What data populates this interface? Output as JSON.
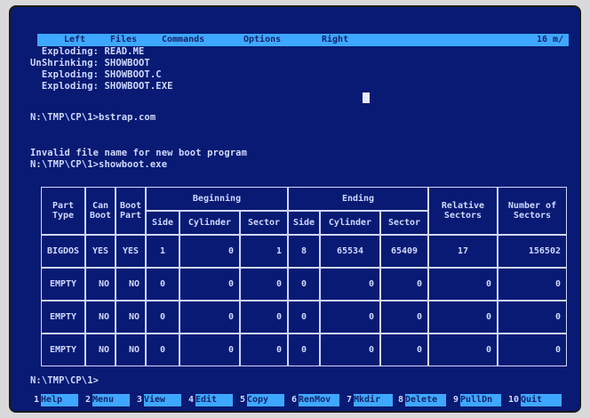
{
  "menu": {
    "items": [
      "Left",
      "Files",
      "Commands",
      "Options",
      "Right"
    ],
    "right_text": "16 m/"
  },
  "console": {
    "lines": [
      "  Exploding: READ.ME",
      "UnShrinking: SHOWBOOT",
      "  Exploding: SHOWBOOT.C",
      "  Exploding: SHOWBOOT.EXE",
      "",
      "N:\\TMP\\CP\\1>bstrap.com",
      "",
      "Invalid file name for new boot program",
      "N:\\TMP\\CP\\1>showboot.exe"
    ]
  },
  "table": {
    "header": {
      "part_type": "Part Type",
      "can_boot": "Can Boot",
      "boot_part": "Boot Part",
      "beginning": "Beginning",
      "ending": "Ending",
      "side": "Side",
      "cylinder": "Cylinder",
      "sector": "Sector",
      "relative": "Relative Sectors",
      "number": "Number of Sectors"
    },
    "rows": [
      {
        "type": "BIGDOS",
        "can": "YES",
        "boot": "YES",
        "bside": "1",
        "bcyl": "0",
        "bsec": "1",
        "eside": "8",
        "ecyl": "65534",
        "esec": "65409",
        "rel": "17",
        "num": "156502"
      },
      {
        "type": "EMPTY",
        "can": "NO",
        "boot": "NO",
        "bside": "0",
        "bcyl": "0",
        "bsec": "0",
        "eside": "0",
        "ecyl": "0",
        "esec": "0",
        "rel": "0",
        "num": "0"
      },
      {
        "type": "EMPTY",
        "can": "NO",
        "boot": "NO",
        "bside": "0",
        "bcyl": "0",
        "bsec": "0",
        "eside": "0",
        "ecyl": "0",
        "esec": "0",
        "rel": "0",
        "num": "0"
      },
      {
        "type": "EMPTY",
        "can": "NO",
        "boot": "NO",
        "bside": "0",
        "bcyl": "0",
        "bsec": "0",
        "eside": "0",
        "ecyl": "0",
        "esec": "0",
        "rel": "0",
        "num": "0"
      }
    ]
  },
  "prompt": "N:\\TMP\\CP\\1>",
  "fkeys": [
    {
      "n": "1",
      "label": "Help"
    },
    {
      "n": "2",
      "label": "Menu"
    },
    {
      "n": "3",
      "label": "View"
    },
    {
      "n": "4",
      "label": "Edit"
    },
    {
      "n": "5",
      "label": "Copy"
    },
    {
      "n": "6",
      "label": "RenMov"
    },
    {
      "n": "7",
      "label": "Mkdir"
    },
    {
      "n": "8",
      "label": "Delete"
    },
    {
      "n": "9",
      "label": "PullDn"
    },
    {
      "n": "10",
      "label": "Quit"
    }
  ]
}
